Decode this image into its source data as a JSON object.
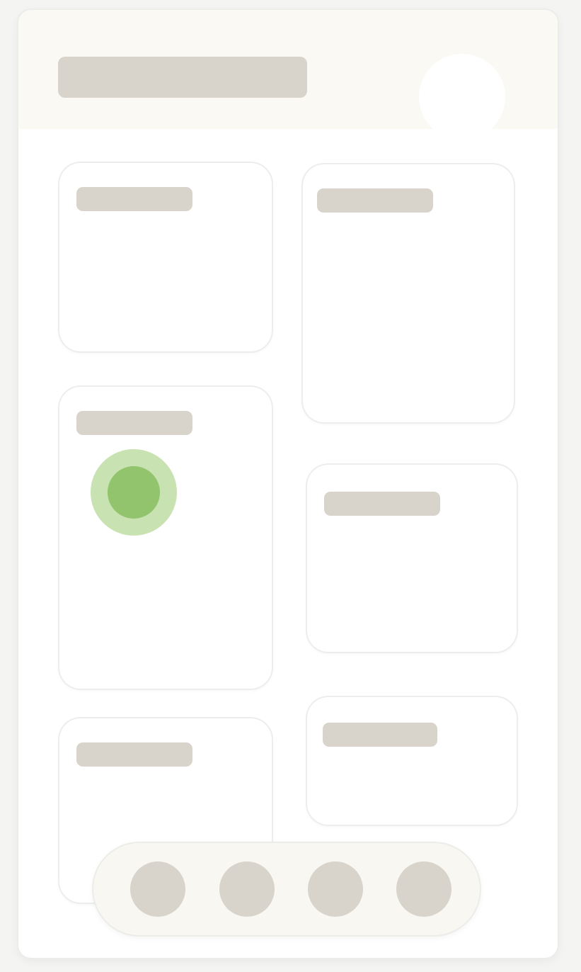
{
  "theme": {
    "page_background": "#f4f4f3",
    "surface": "#ffffff",
    "header_background": "#faf9f3",
    "placeholder": "#d8d4cc",
    "status_ring": "#c9e2b1",
    "status_dot": "#91c46c",
    "dock_background": "#f8f7f1"
  },
  "header": {
    "title_placeholder": "placeholder-bar",
    "avatar_icon": "avatar-circle"
  },
  "cards": [
    {
      "id": "card-1",
      "title_placeholder": "placeholder-bar"
    },
    {
      "id": "card-2",
      "title_placeholder": "placeholder-bar"
    },
    {
      "id": "card-3",
      "title_placeholder": "placeholder-bar",
      "status_icon": "status-dot-icon",
      "status_color": "#91c46c"
    },
    {
      "id": "card-4",
      "title_placeholder": "placeholder-bar"
    },
    {
      "id": "card-5",
      "title_placeholder": "placeholder-bar"
    },
    {
      "id": "card-6",
      "title_placeholder": "placeholder-bar"
    }
  ],
  "dock": {
    "items": [
      {
        "icon": "dock-circle-icon"
      },
      {
        "icon": "dock-circle-icon"
      },
      {
        "icon": "dock-circle-icon"
      },
      {
        "icon": "dock-circle-icon"
      }
    ]
  }
}
